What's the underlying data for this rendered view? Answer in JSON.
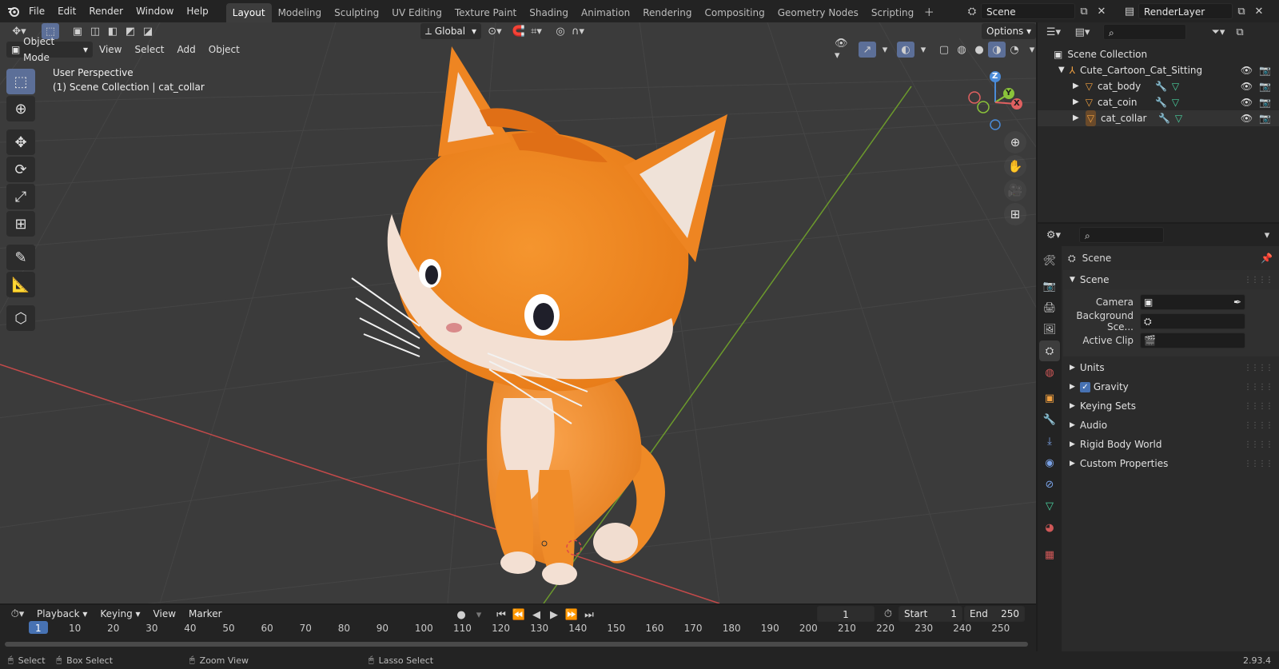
{
  "colors": {
    "accent": "#4772b3",
    "active_tab": "#3d3d3d",
    "viewport_bg": "#3b3b3b",
    "x_axis": "#e06060",
    "y_axis": "#8ac23a",
    "z_axis": "#4a8bd8",
    "cat_orange": "#f28f2c"
  },
  "topbar": {
    "menus": [
      "File",
      "Edit",
      "Render",
      "Window",
      "Help"
    ],
    "workspaces": [
      "Layout",
      "Modeling",
      "Sculpting",
      "UV Editing",
      "Texture Paint",
      "Shading",
      "Animation",
      "Rendering",
      "Compositing",
      "Geometry Nodes",
      "Scripting"
    ],
    "active_workspace": "Layout",
    "scene": "Scene",
    "view_layer": "RenderLayer"
  },
  "viewport": {
    "transform_orientation": "Global",
    "options_label": "Options",
    "mode": "Object Mode",
    "menus": [
      "View",
      "Select",
      "Add",
      "Object"
    ],
    "overlay_line1": "User Perspective",
    "overlay_line2": "(1) Scene Collection | cat_collar",
    "gizmo": {
      "x": "X",
      "y": "Y",
      "z": "Z"
    }
  },
  "outliner": {
    "root": "Scene Collection",
    "collection": "Cute_Cartoon_Cat_Sitting",
    "objects": [
      "cat_body",
      "cat_coin",
      "cat_collar"
    ]
  },
  "properties": {
    "search_placeholder": "",
    "context": "Scene",
    "panel_title": "Scene",
    "fields": {
      "camera_label": "Camera",
      "background_label": "Background Sce...",
      "clip_label": "Active Clip"
    },
    "sections": [
      "Units",
      "Gravity",
      "Keying Sets",
      "Audio",
      "Rigid Body World",
      "Custom Properties"
    ],
    "gravity_checked": true
  },
  "timeline": {
    "menus": [
      "Playback",
      "Keying",
      "View",
      "Marker"
    ],
    "current_frame": "1",
    "start_label": "Start",
    "start": "1",
    "end_label": "End",
    "end": "250",
    "ticks": [
      "1",
      "10",
      "20",
      "30",
      "40",
      "50",
      "60",
      "70",
      "80",
      "90",
      "100",
      "110",
      "120",
      "130",
      "140",
      "150",
      "160",
      "170",
      "180",
      "190",
      "200",
      "210",
      "220",
      "230",
      "240",
      "250"
    ]
  },
  "statusbar": {
    "select": "Select",
    "box_select": "Box Select",
    "zoom_view": "Zoom View",
    "lasso_select": "Lasso Select",
    "version": "2.93.4"
  }
}
